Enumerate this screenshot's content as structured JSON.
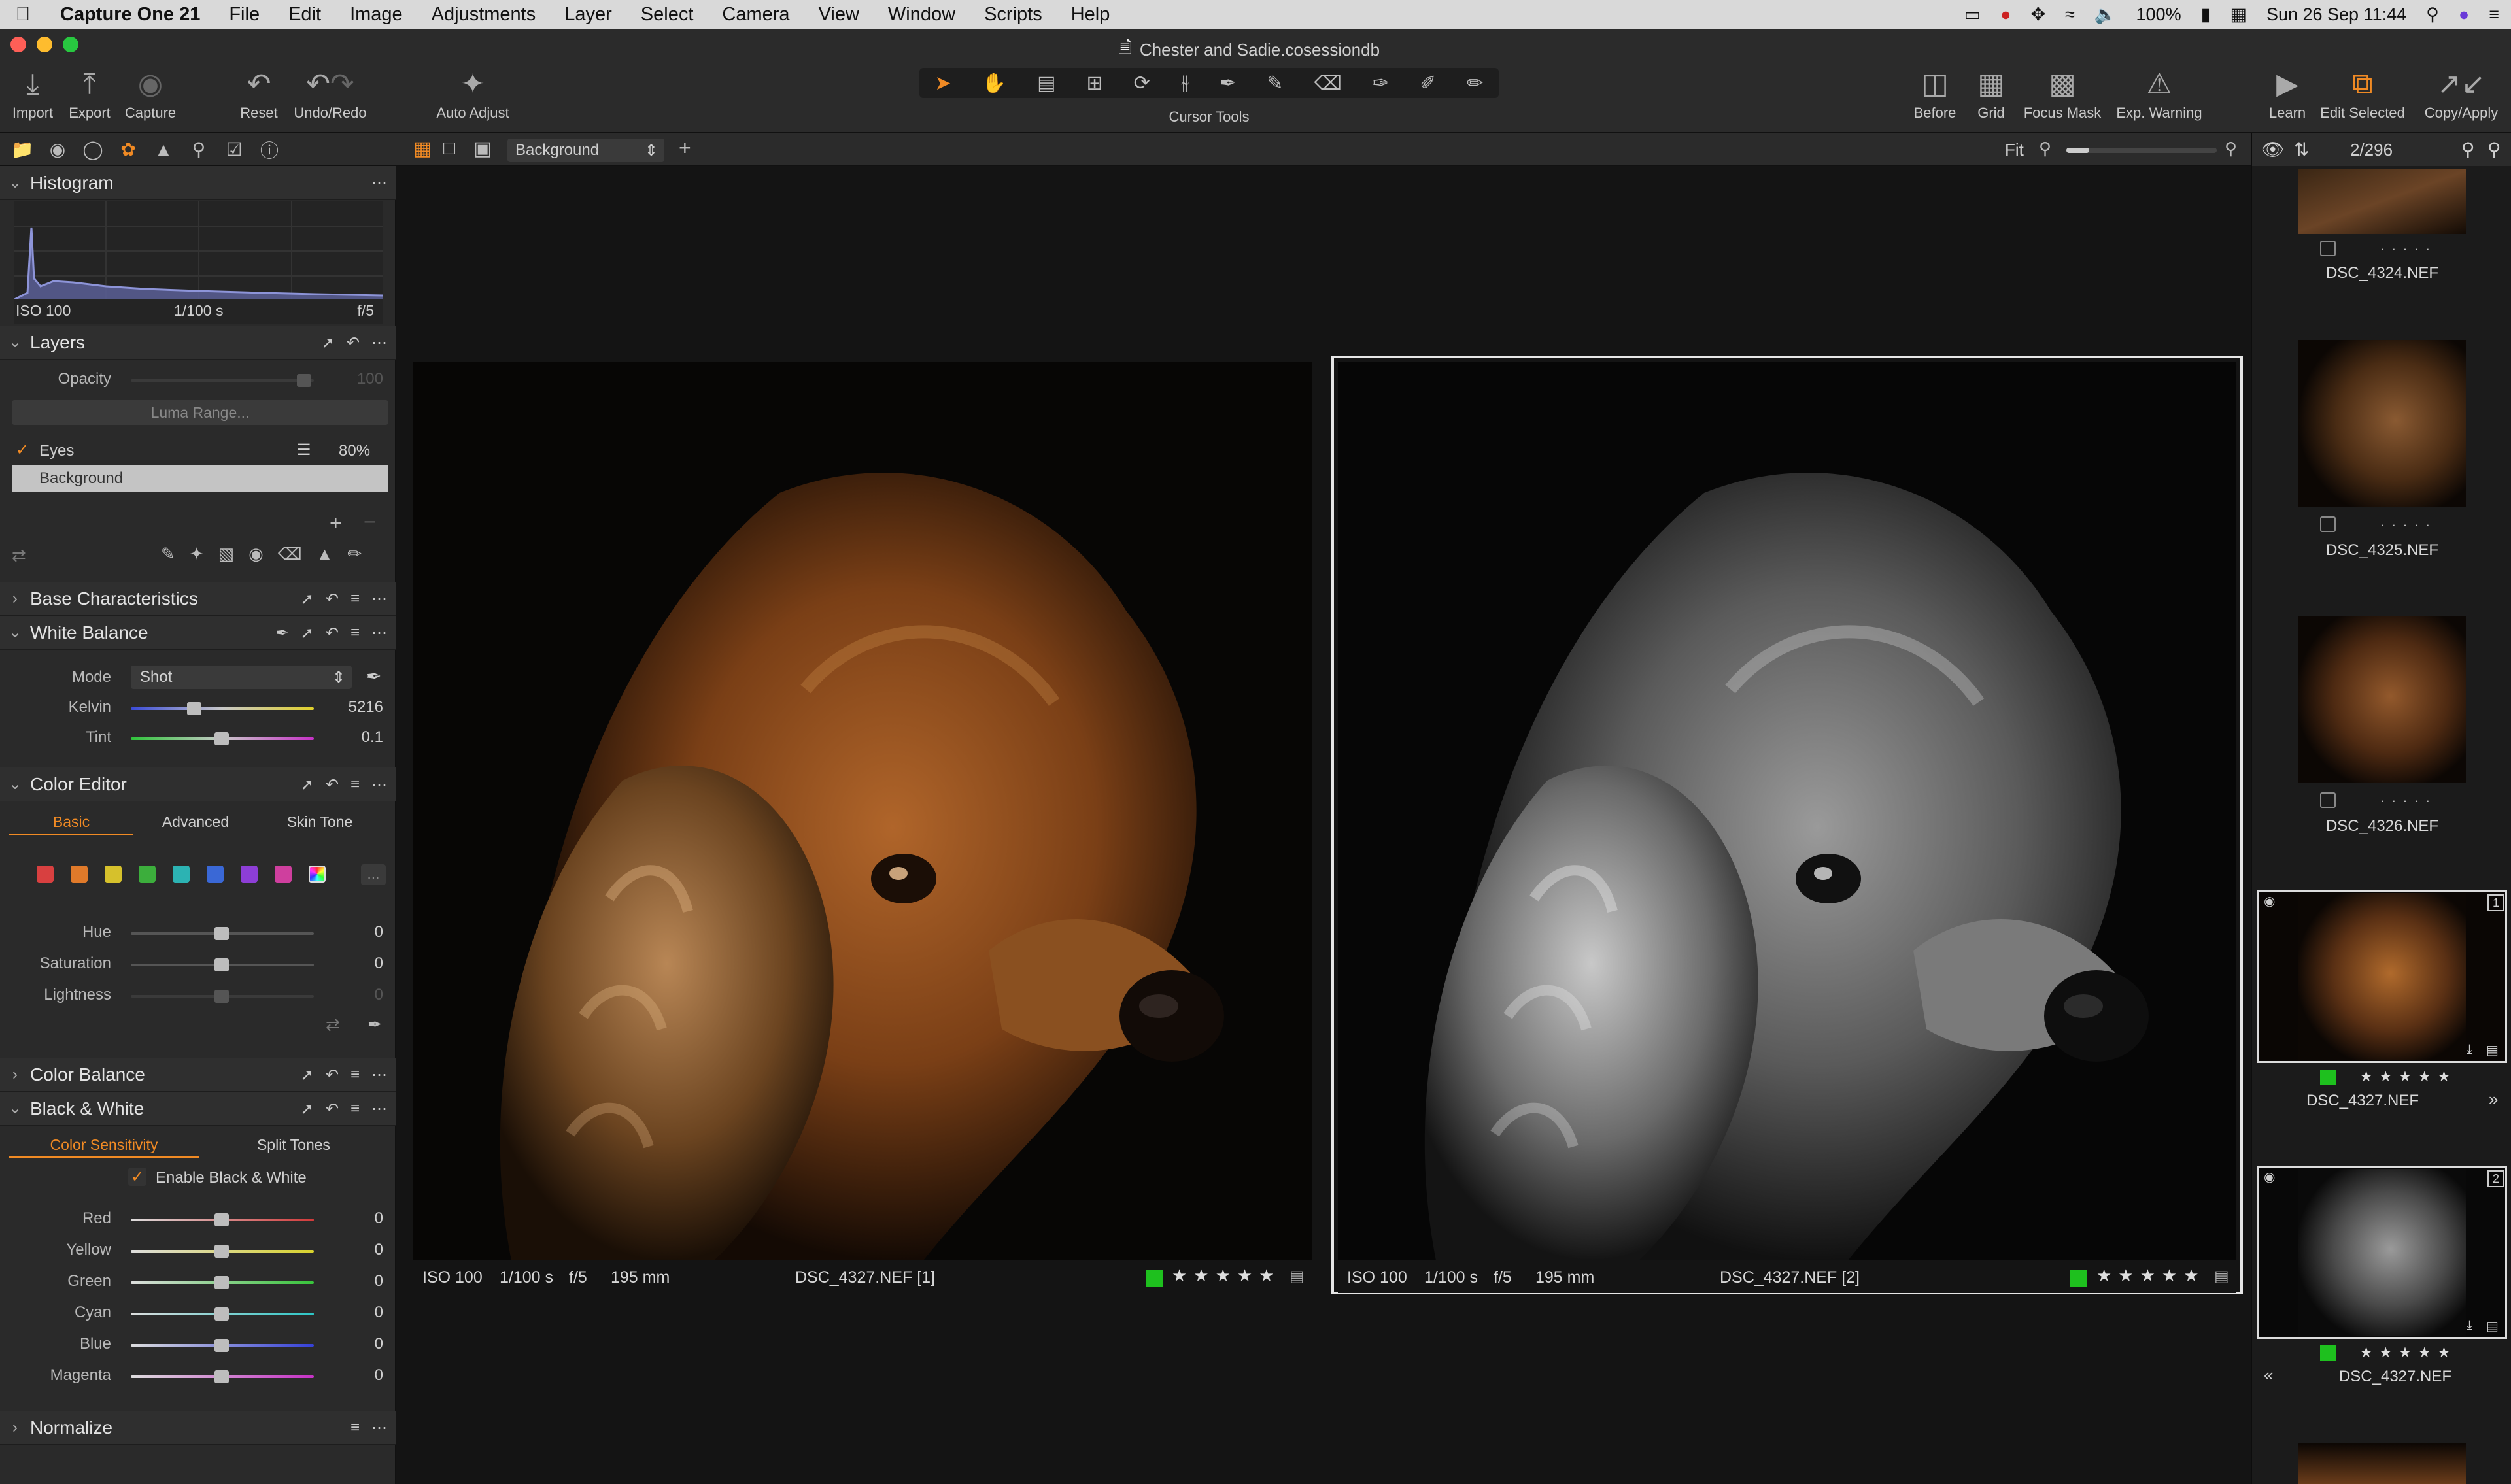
{
  "menubar": {
    "app_name": "Capture One 21",
    "items": [
      "File",
      "Edit",
      "Image",
      "Adjustments",
      "Layer",
      "Select",
      "Camera",
      "View",
      "Window",
      "Scripts",
      "Help"
    ],
    "battery": "100%",
    "clock": "Sun 26 Sep  11:44"
  },
  "window": {
    "title": "Chester and Sadie.cosessiondb"
  },
  "toolbar": {
    "import": "Import",
    "export": "Export",
    "capture": "Capture",
    "reset": "Reset",
    "undo_redo": "Undo/Redo",
    "auto_adjust": "Auto Adjust",
    "cursor_tools": "Cursor Tools",
    "before": "Before",
    "grid": "Grid",
    "focus_mask": "Focus Mask",
    "exp_warning": "Exp. Warning",
    "learn": "Learn",
    "edit_selected": "Edit Selected",
    "copy_apply": "Copy/Apply"
  },
  "viewer_bar": {
    "layer_select": "Background",
    "fit": "Fit",
    "zoom_level": 0.15
  },
  "histogram": {
    "title": "Histogram",
    "iso": "ISO 100",
    "shutter": "1/100 s",
    "aperture": "f/5"
  },
  "layers": {
    "title": "Layers",
    "opacity_label": "Opacity",
    "opacity_value": "100",
    "luma_range": "Luma Range...",
    "items": [
      {
        "name": "Eyes",
        "value": "80%"
      },
      {
        "name": "Background"
      }
    ]
  },
  "base_characteristics": {
    "title": "Base Characteristics"
  },
  "white_balance": {
    "title": "White Balance",
    "mode_label": "Mode",
    "mode_value": "Shot",
    "kelvin_label": "Kelvin",
    "kelvin_value": "5216",
    "tint_label": "Tint",
    "tint_value": "0.1"
  },
  "color_editor": {
    "title": "Color Editor",
    "tabs": [
      "Basic",
      "Advanced",
      "Skin Tone"
    ],
    "swatches": [
      "#d84040",
      "#e07a2a",
      "#d6c12c",
      "#3cae3c",
      "#2cb3b3",
      "#3a68d6",
      "#8d3ed6",
      "#cf3f9e"
    ],
    "more": "...",
    "hue_label": "Hue",
    "hue_value": "0",
    "saturation_label": "Saturation",
    "saturation_value": "0",
    "lightness_label": "Lightness",
    "lightness_value": "0"
  },
  "color_balance": {
    "title": "Color Balance"
  },
  "black_white": {
    "title": "Black & White",
    "tabs": [
      "Color Sensitivity",
      "Split Tones"
    ],
    "enable_label": "Enable Black & White",
    "sliders": [
      {
        "label": "Red",
        "value": "0",
        "color": "#d23a3a"
      },
      {
        "label": "Yellow",
        "value": "0",
        "color": "#d8d22c"
      },
      {
        "label": "Green",
        "value": "0",
        "color": "#37c43a"
      },
      {
        "label": "Cyan",
        "value": "0",
        "color": "#2cc6c6"
      },
      {
        "label": "Blue",
        "value": "0",
        "color": "#3440d8"
      },
      {
        "label": "Magenta",
        "value": "0",
        "color": "#c631c6"
      }
    ]
  },
  "normalize": {
    "title": "Normalize"
  },
  "viewer": {
    "left": {
      "iso": "ISO 100",
      "shutter": "1/100 s",
      "aperture": "f/5",
      "focal": "195 mm",
      "filename": "DSC_4327.NEF [1]"
    },
    "right": {
      "iso": "ISO 100",
      "shutter": "1/100 s",
      "aperture": "f/5",
      "focal": "195 mm",
      "filename": "DSC_4327.NEF [2]"
    }
  },
  "browser": {
    "count": "2/296",
    "thumbs": [
      {
        "name": "DSC_4324.NEF"
      },
      {
        "name": "DSC_4325.NEF"
      },
      {
        "name": "DSC_4326.NEF"
      },
      {
        "name": "DSC_4327.NEF",
        "badge": "1"
      },
      {
        "name": "DSC_4327.NEF",
        "badge": "2"
      }
    ]
  },
  "colors": {
    "accent": "#f08a24",
    "color_tag_green": "#1ec01e",
    "selection_border": "#e6e6e6"
  }
}
